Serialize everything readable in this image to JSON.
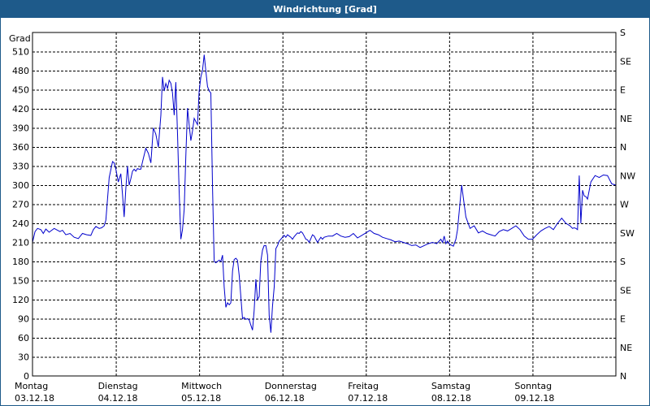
{
  "window": {
    "title": "Windrichtung [Grad]"
  },
  "colors": {
    "titlebar": "#1e5a8a",
    "line": "#0000cc",
    "grid": "#000000"
  },
  "chart_data": {
    "type": "line",
    "title": "Windrichtung [Grad]",
    "ylabel": "Grad",
    "ylim": [
      0,
      540
    ],
    "yticks": [
      0,
      30,
      60,
      90,
      120,
      150,
      180,
      210,
      240,
      270,
      300,
      330,
      360,
      390,
      420,
      450,
      480,
      510
    ],
    "right_axis_labels": [
      {
        "value": 0,
        "label": "N"
      },
      {
        "value": 45,
        "label": "NE"
      },
      {
        "value": 90,
        "label": "E"
      },
      {
        "value": 135,
        "label": "SE"
      },
      {
        "value": 180,
        "label": "S"
      },
      {
        "value": 225,
        "label": "SW"
      },
      {
        "value": 270,
        "label": "W"
      },
      {
        "value": 315,
        "label": "NW"
      },
      {
        "value": 360,
        "label": "N"
      },
      {
        "value": 405,
        "label": "NE"
      },
      {
        "value": 450,
        "label": "E"
      },
      {
        "value": 495,
        "label": "SE"
      },
      {
        "value": 540,
        "label": "S"
      }
    ],
    "xlim": [
      0,
      7
    ],
    "days": [
      {
        "day": "Montag",
        "date": "03.12.18"
      },
      {
        "day": "Dienstag",
        "date": "04.12.18"
      },
      {
        "day": "Mittwoch",
        "date": "05.12.18"
      },
      {
        "day": "Donnerstag",
        "date": "06.12.18"
      },
      {
        "day": "Freitag",
        "date": "07.12.18"
      },
      {
        "day": "Samstag",
        "date": "08.12.18"
      },
      {
        "day": "Sonntag",
        "date": "09.12.18"
      }
    ],
    "grid": true,
    "series": [
      {
        "x": [
          0,
          0.03,
          0.06,
          0.1,
          0.13,
          0.16,
          0.2,
          0.23,
          0.26,
          0.3,
          0.33,
          0.36,
          0.4,
          0.45,
          0.5,
          0.55,
          0.58,
          0.6,
          0.65,
          0.7,
          0.73,
          0.76,
          0.8,
          0.83,
          0.86,
          0.88,
          0.92,
          0.96,
          0.98,
          1.0,
          1.03,
          1.06,
          1.08,
          1.1,
          1.12,
          1.14,
          1.16,
          1.18,
          1.2,
          1.22,
          1.24,
          1.26,
          1.28,
          1.3,
          1.33,
          1.36,
          1.39,
          1.42,
          1.45,
          1.48,
          1.51,
          1.54,
          1.56,
          1.58,
          1.6,
          1.62,
          1.64,
          1.66,
          1.68,
          1.7,
          1.72,
          1.74,
          1.76,
          1.78,
          1.8,
          1.82,
          1.84,
          1.86,
          1.88,
          1.9,
          1.92,
          1.94,
          1.96,
          1.98,
          2.0,
          2.02,
          2.04,
          2.06,
          2.08,
          2.1,
          2.12,
          2.14,
          2.16,
          2.18,
          2.2,
          2.22,
          2.24,
          2.26,
          2.28,
          2.3,
          2.32,
          2.34,
          2.36,
          2.38,
          2.4,
          2.42,
          2.44,
          2.46,
          2.48,
          2.5,
          2.52,
          2.54,
          2.56,
          2.58,
          2.6,
          2.62,
          2.64,
          2.66,
          2.68,
          2.7,
          2.72,
          2.74,
          2.76,
          2.78,
          2.8,
          2.82,
          2.84,
          2.86,
          2.88,
          2.9,
          2.92,
          2.94,
          2.96,
          2.98,
          3.0,
          3.02,
          3.04,
          3.06,
          3.08,
          3.1,
          3.12,
          3.14,
          3.16,
          3.18,
          3.2,
          3.22,
          3.24,
          3.26,
          3.28,
          3.3,
          3.32,
          3.34,
          3.36,
          3.38,
          3.4,
          3.42,
          3.44,
          3.46,
          3.48,
          3.5,
          3.55,
          3.6,
          3.65,
          3.7,
          3.75,
          3.8,
          3.85,
          3.9,
          3.95,
          4.0,
          4.05,
          4.1,
          4.15,
          4.2,
          4.25,
          4.3,
          4.35,
          4.4,
          4.45,
          4.5,
          4.55,
          4.6,
          4.65,
          4.7,
          4.75,
          4.8,
          4.85,
          4.9,
          4.92,
          4.94,
          4.96,
          4.98,
          5.0,
          5.02,
          5.05,
          5.08,
          5.1,
          5.15,
          5.2,
          5.25,
          5.3,
          5.35,
          5.4,
          5.45,
          5.5,
          5.55,
          5.6,
          5.65,
          5.7,
          5.75,
          5.8,
          5.85,
          5.9,
          5.95,
          6.0,
          6.05,
          6.1,
          6.15,
          6.2,
          6.25,
          6.3,
          6.35,
          6.4,
          6.45,
          6.48,
          6.5,
          6.52,
          6.54,
          6.56,
          6.58,
          6.6,
          6.62,
          6.64,
          6.66,
          6.7,
          6.75,
          6.8,
          6.85,
          6.9,
          6.95,
          7.0
        ],
        "y": [
          210,
          227,
          232,
          230,
          224,
          231,
          226,
          229,
          232,
          229,
          227,
          229,
          222,
          224,
          218,
          216,
          221,
          224,
          222,
          221,
          230,
          235,
          232,
          233,
          236,
          245,
          312,
          337,
          335,
          325,
          305,
          318,
          285,
          250,
          295,
          330,
          300,
          310,
          322,
          325,
          322,
          326,
          325,
          325,
          342,
          358,
          350,
          335,
          390,
          380,
          360,
          410,
          470,
          448,
          460,
          452,
          465,
          460,
          445,
          410,
          462,
          380,
          290,
          215,
          230,
          262,
          345,
          421,
          395,
          370,
          385,
          405,
          400,
          395,
          448,
          470,
          480,
          505,
          480,
          455,
          448,
          445,
          295,
          180,
          178,
          180,
          182,
          180,
          190,
          140,
          108,
          115,
          112,
          115,
          165,
          183,
          185,
          182,
          158,
          125,
          90,
          92,
          89,
          90,
          88,
          80,
          72,
          103,
          152,
          120,
          125,
          180,
          198,
          205,
          205,
          190,
          95,
          68,
          110,
          140,
          200,
          205,
          212,
          215,
          218,
          221,
          218,
          222,
          220,
          218,
          215,
          219,
          222,
          225,
          224,
          227,
          225,
          220,
          215,
          214,
          210,
          216,
          222,
          220,
          215,
          210,
          214,
          218,
          215,
          218,
          220,
          220,
          224,
          220,
          218,
          219,
          224,
          217,
          221,
          225,
          229,
          224,
          222,
          218,
          216,
          214,
          211,
          212,
          210,
          208,
          205,
          206,
          202,
          205,
          208,
          210,
          208,
          215,
          210,
          220,
          208,
          212,
          208,
          206,
          204,
          215,
          230,
          300,
          250,
          232,
          236,
          225,
          228,
          224,
          222,
          220,
          227,
          230,
          228,
          232,
          236,
          230,
          220,
          215,
          215,
          222,
          228,
          232,
          235,
          230,
          240,
          248,
          240,
          236,
          232,
          233,
          232,
          230,
          315,
          240,
          292,
          283,
          282,
          278,
          305,
          315,
          312,
          316,
          315,
          302,
          300
        ]
      }
    ]
  }
}
